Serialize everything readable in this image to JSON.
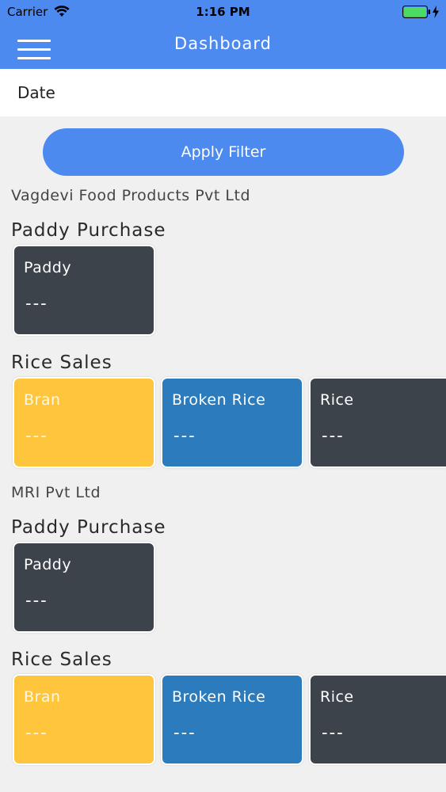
{
  "status_bar": {
    "carrier": "Carrier",
    "time": "1:16 PM",
    "icons": [
      "wifi-icon",
      "battery-icon",
      "charging-bolt-icon"
    ]
  },
  "header": {
    "title": "Dashboard",
    "menu_icon": "hamburger-menu-icon",
    "background": "#4d8af0"
  },
  "filter": {
    "date_label": "Date",
    "apply_label": "Apply Filter"
  },
  "companies": [
    {
      "name": "Vagdevi Food Products Pvt Ltd",
      "paddy_purchase": {
        "title": "Paddy Purchase",
        "cards": [
          {
            "label": "Paddy",
            "value": "---",
            "color": "#3c434b"
          }
        ]
      },
      "rice_sales": {
        "title": "Rice Sales",
        "cards": [
          {
            "label": "Bran",
            "value": "---",
            "color": "#ffc63d"
          },
          {
            "label": "Broken Rice",
            "value": "---",
            "color": "#2b7bbd"
          },
          {
            "label": "Rice",
            "value": "---",
            "color": "#3c434b"
          }
        ]
      }
    },
    {
      "name": "MRI Pvt Ltd",
      "paddy_purchase": {
        "title": "Paddy Purchase",
        "cards": [
          {
            "label": "Paddy",
            "value": "---",
            "color": "#3c434b"
          }
        ]
      },
      "rice_sales": {
        "title": "Rice Sales",
        "cards": [
          {
            "label": "Bran",
            "value": "---",
            "color": "#ffc63d"
          },
          {
            "label": "Broken Rice",
            "value": "---",
            "color": "#2b7bbd"
          },
          {
            "label": "Rice",
            "value": "---",
            "color": "#3c434b"
          }
        ]
      }
    }
  ]
}
